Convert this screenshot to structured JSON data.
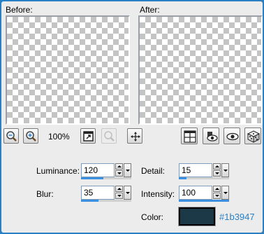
{
  "preview": {
    "before_label": "Before:",
    "after_label": "After:"
  },
  "toolbar": {
    "zoom_level": "100%"
  },
  "settings": {
    "luminance": {
      "label": "Luminance:",
      "value": "120",
      "fraction": 0.45
    },
    "detail": {
      "label": "Detail:",
      "value": "15",
      "fraction": 0.15
    },
    "blur": {
      "label": "Blur:",
      "value": "35",
      "fraction": 0.35
    },
    "intensity": {
      "label": "Intensity:",
      "value": "100",
      "fraction": 1.0
    },
    "color": {
      "label": "Color:",
      "hex": "#1b3947"
    }
  },
  "colors": {
    "accent": "#2b7fc3",
    "slider_fill": "#3d8fe0",
    "swatch": "#1b3947"
  }
}
